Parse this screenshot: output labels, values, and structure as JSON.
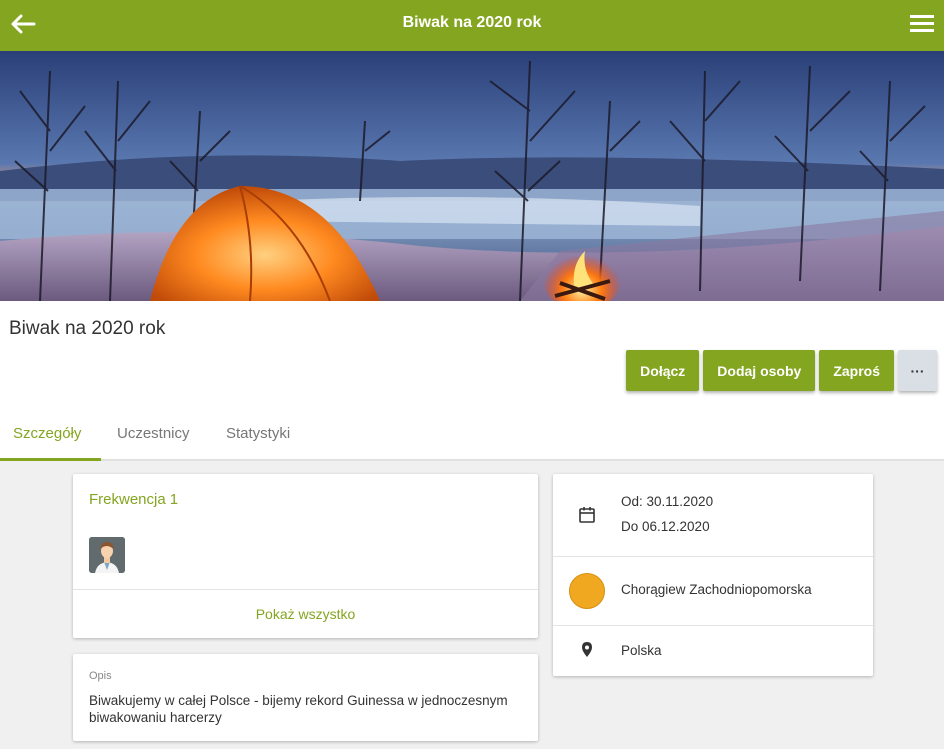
{
  "topbar": {
    "title": "Biwak na 2020 rok",
    "back_icon": "arrow-left-icon",
    "menu_icon": "hamburger-menu-icon"
  },
  "banner": {
    "image": "winter-camping-scene-with-orange-tent-and-campfire-by-lake"
  },
  "event": {
    "title": "Biwak na 2020 rok"
  },
  "actions": {
    "join": "Dołącz",
    "add_people": "Dodaj osoby",
    "invite": "Zaproś",
    "more": "···"
  },
  "tabs": [
    {
      "label": "Szczegóły",
      "active": true
    },
    {
      "label": "Uczestnicy",
      "active": false
    },
    {
      "label": "Statystyki",
      "active": false
    }
  ],
  "attendance": {
    "title": "Frekwencja",
    "count": "1",
    "show_all": "Pokaż wszystko"
  },
  "description": {
    "label": "Opis",
    "text": "Biwakujemy w całej Polsce - bijemy rekord Guinessa w jednoczesnym biwakowaniu harcerzy"
  },
  "info": {
    "date_from": "Od: 30.11.2020",
    "date_to": "Do 06.12.2020",
    "organization": "Chorągiew Zachodniopomorska",
    "location": "Polska"
  },
  "colors": {
    "primary": "#84a520",
    "org_badge": "#f0a820",
    "more_button": "#d9dfe5"
  }
}
